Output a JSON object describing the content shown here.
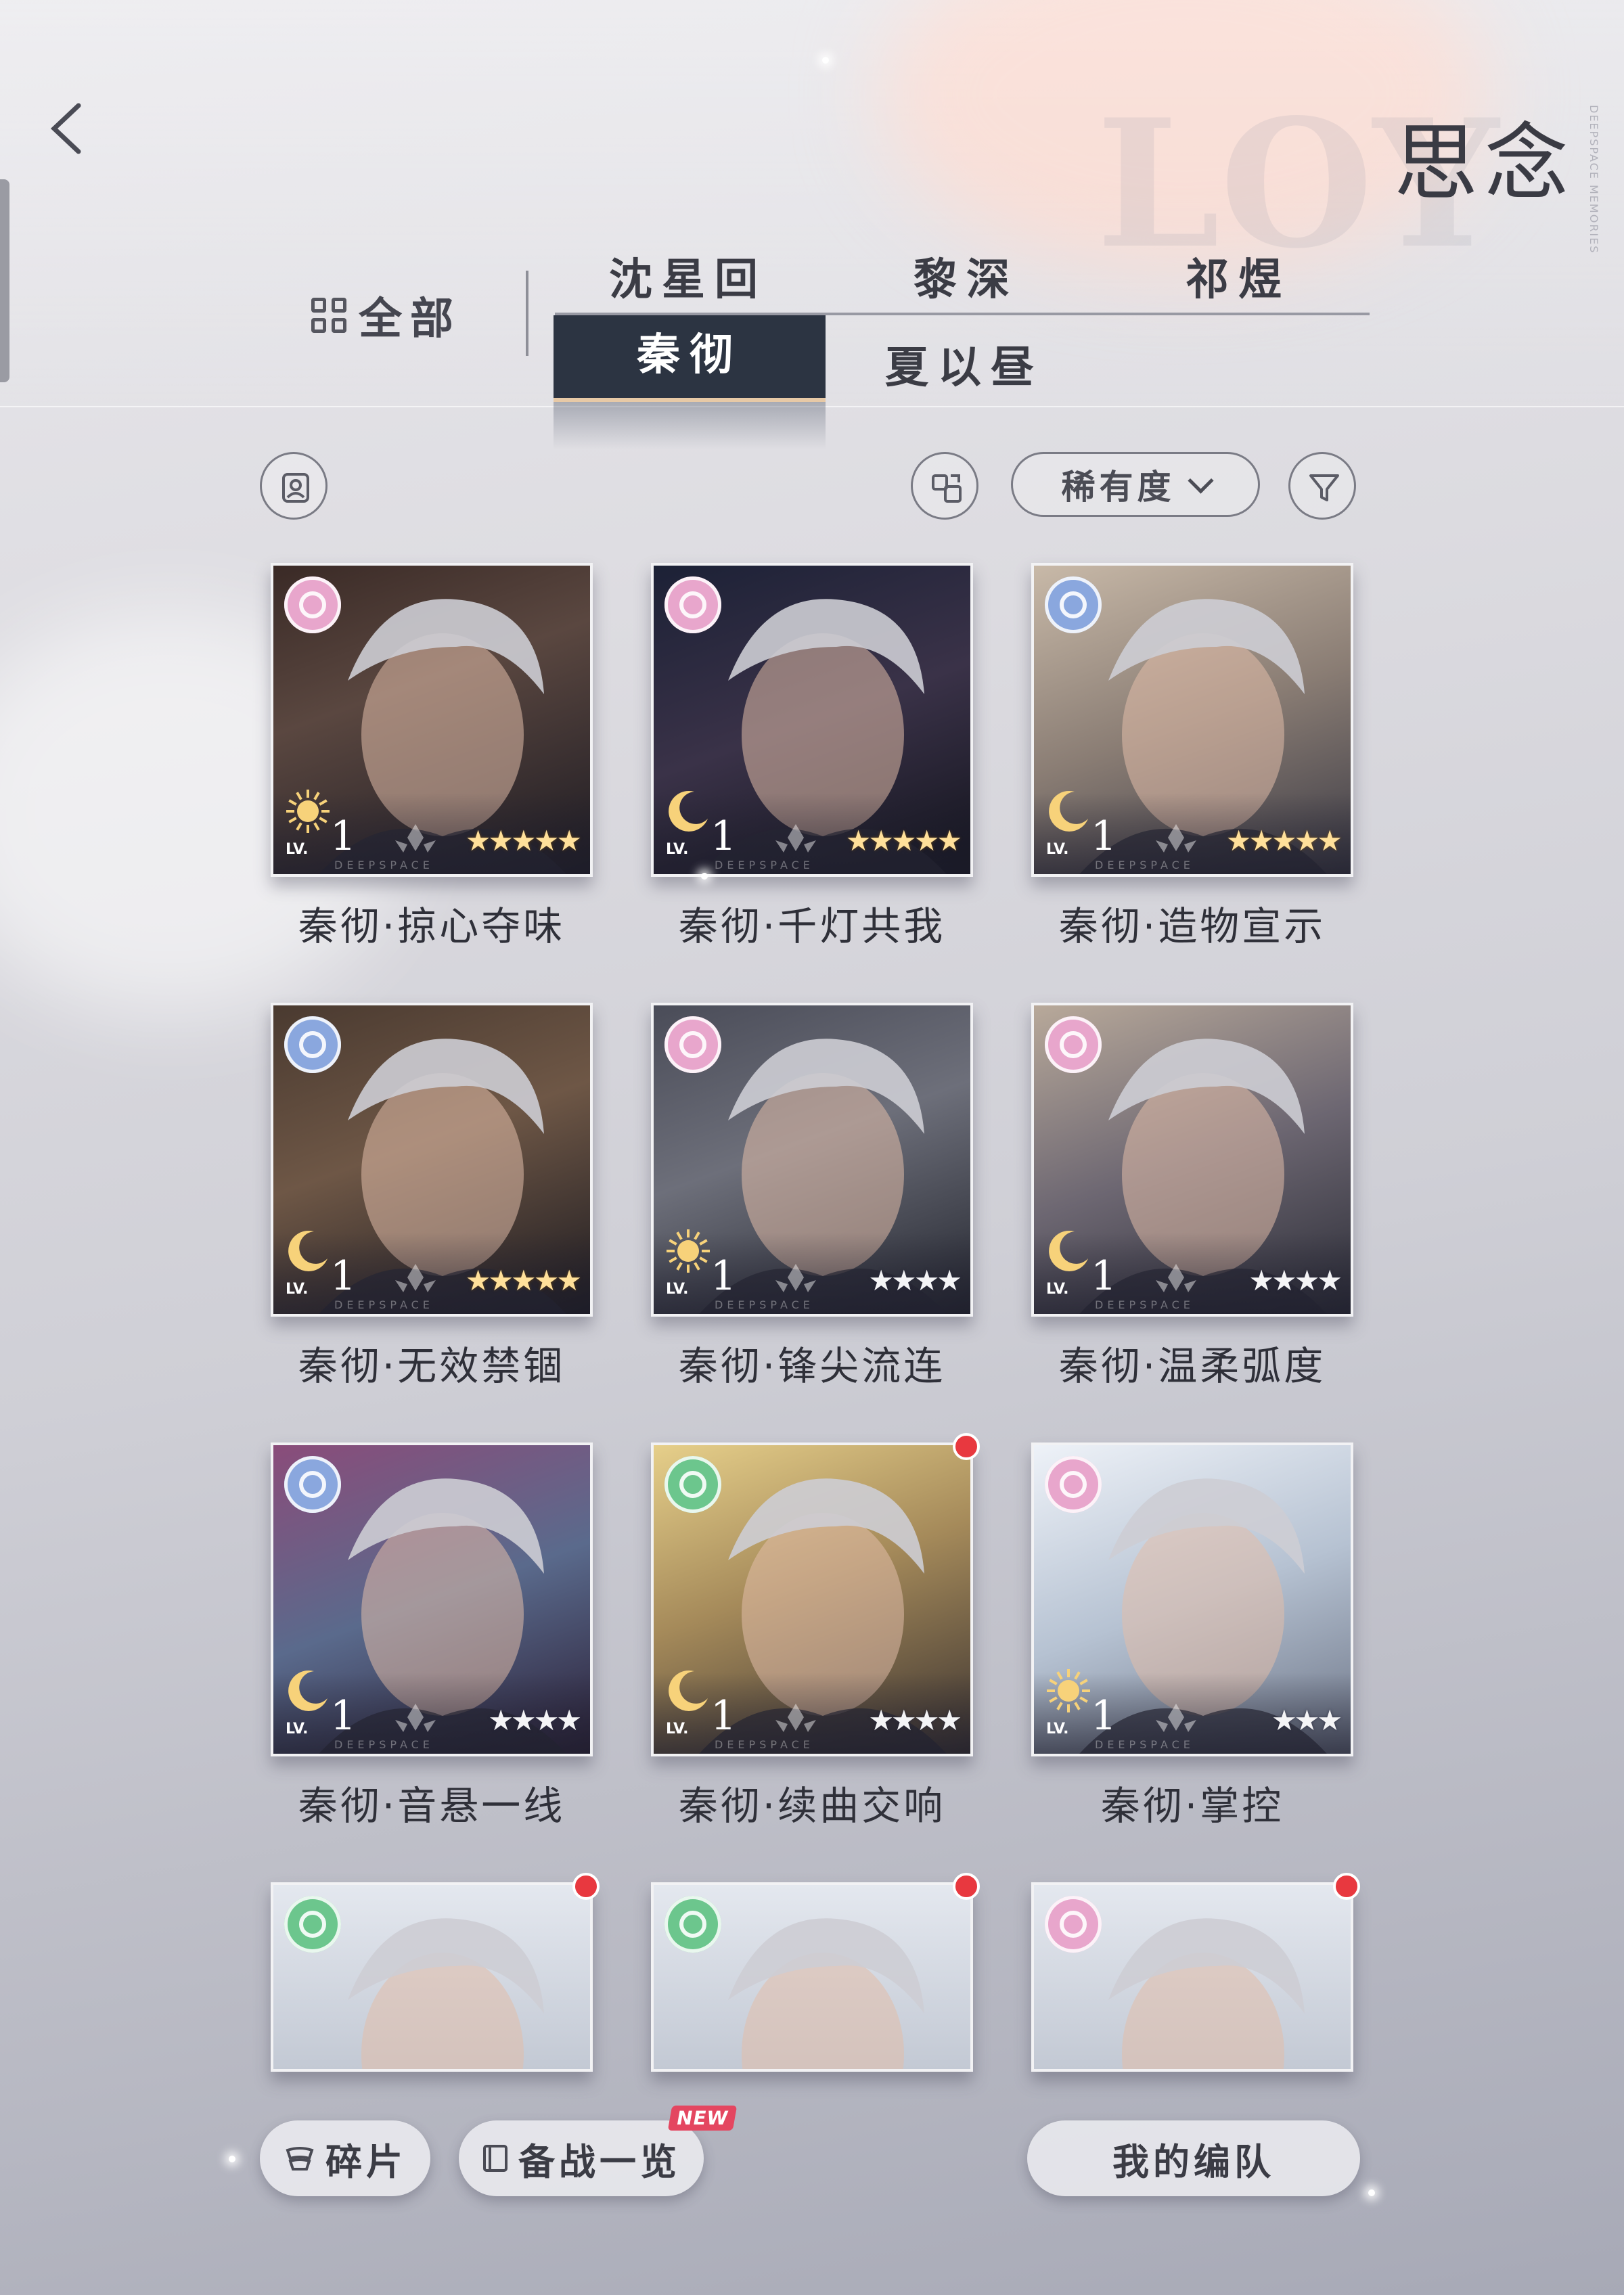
{
  "header": {
    "title": "思念",
    "title_sub": "DEEPSPACE MEMORIES",
    "back_icon": "chevron-left-icon"
  },
  "filters": {
    "all_label": "全部",
    "characters_row1": [
      "沈星回",
      "黎深",
      "祁煜"
    ],
    "characters_row2": [
      "秦彻",
      "夏以昼"
    ],
    "active_character": "秦彻",
    "sort_label": "稀有度"
  },
  "cards": [
    {
      "name": "秦彻·掠心夺味",
      "gem": "pink",
      "astro": "sun",
      "level": "1",
      "stars": "★★★★★",
      "star_color": "gold",
      "new_dot": false
    },
    {
      "name": "秦彻·千灯共我",
      "gem": "pink",
      "astro": "moon",
      "level": "1",
      "stars": "★★★★★",
      "star_color": "gold",
      "new_dot": false
    },
    {
      "name": "秦彻·造物宣示",
      "gem": "blue",
      "astro": "moon",
      "level": "1",
      "stars": "★★★★★",
      "star_color": "gold",
      "new_dot": false
    },
    {
      "name": "秦彻·无效禁锢",
      "gem": "blue",
      "astro": "moon",
      "level": "1",
      "stars": "★★★★★",
      "star_color": "gold",
      "new_dot": false
    },
    {
      "name": "秦彻·锋尖流连",
      "gem": "pink",
      "astro": "sun",
      "level": "1",
      "stars": "★★★★",
      "star_color": "silver",
      "new_dot": false
    },
    {
      "name": "秦彻·温柔弧度",
      "gem": "pink",
      "astro": "moon",
      "level": "1",
      "stars": "★★★★",
      "star_color": "silver",
      "new_dot": false
    },
    {
      "name": "秦彻·音悬一线",
      "gem": "blue",
      "astro": "moon",
      "level": "1",
      "stars": "★★★★",
      "star_color": "silver",
      "new_dot": false
    },
    {
      "name": "秦彻·续曲交响",
      "gem": "green",
      "astro": "moon",
      "level": "1",
      "stars": "★★★★",
      "star_color": "silver",
      "new_dot": true
    },
    {
      "name": "秦彻·掌控",
      "gem": "pink",
      "astro": "sun",
      "level": "1",
      "stars": "★★★",
      "star_color": "silver",
      "new_dot": false
    },
    {
      "name": "",
      "gem": "green",
      "new_dot": true
    },
    {
      "name": "",
      "gem": "green",
      "new_dot": true
    },
    {
      "name": "",
      "gem": "pink",
      "new_dot": true
    }
  ],
  "card_lv_label": "LV.",
  "card_watermark": "DEEPSPACE",
  "bottom": {
    "fragments_label": "碎片",
    "prep_label": "备战一览",
    "new_badge": "NEW",
    "team_label": "我的编队"
  },
  "colors": {
    "tab_active_bg": "#2c3442",
    "gem_pink": "#e8a6cc",
    "gem_blue": "#8aa7de",
    "gem_green": "#6cc68d",
    "new_dot": "#e8383f",
    "new_badge": "#e44660"
  }
}
